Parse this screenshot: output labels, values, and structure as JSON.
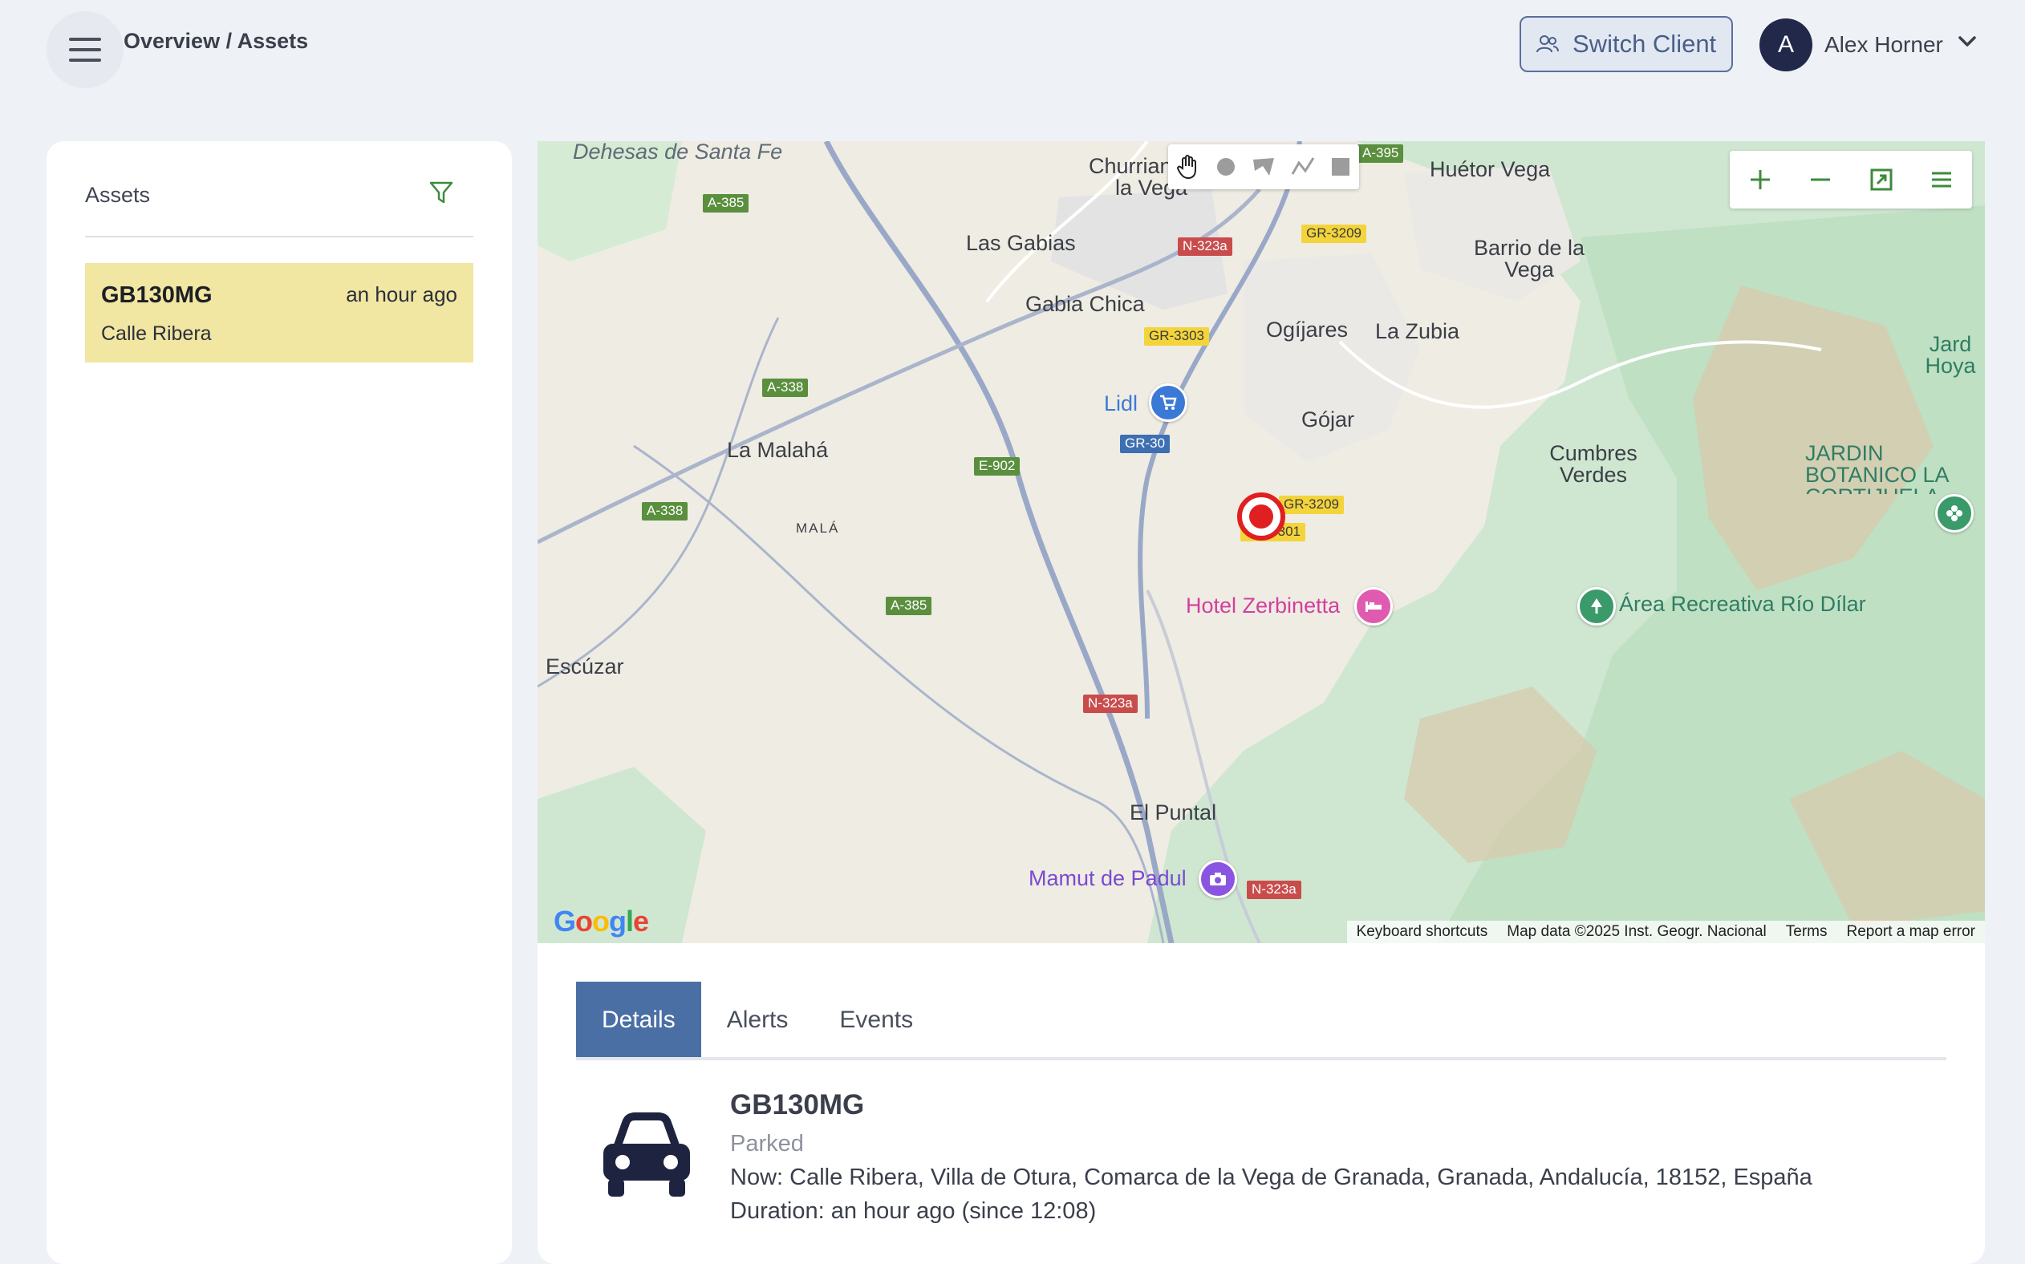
{
  "header": {
    "breadcrumb": "Overview / Assets",
    "switch_client_label": "Switch Client",
    "avatar_initial": "A",
    "user_name": "Alex Horner"
  },
  "assets_panel": {
    "title": "Assets",
    "items": [
      {
        "id": "GB130MG",
        "time": "an hour ago",
        "location": "Calle Ribera"
      }
    ]
  },
  "map": {
    "places": {
      "dehesas": "Dehesas de Santa Fe",
      "churriana": "Churriana de la Vega",
      "huetor": "Huétor Vega",
      "las_gabias": "Las Gabias",
      "barrio": "Barrio de la Vega",
      "gabia_chica": "Gabia Chica",
      "ogijares": "Ogíjares",
      "la_zubia": "La Zubia",
      "jard_hoya": "Jard Hoya",
      "lidl": "Lidl",
      "gojar": "Gójar",
      "la_malaha": "La Malahá",
      "cumbres": "Cumbres Verdes",
      "jardin": "JARDIN BOTANICO LA CORTIJUELA",
      "mala": "MALÁ",
      "hotel": "Hotel Zerbinetta",
      "area": "Área Recreativa Río Dílar",
      "escuzar": "Escúzar",
      "el_puntal": "El Puntal",
      "mamut": "Mamut de Padul"
    },
    "roads": {
      "a385a": "A-385",
      "a395": "A-395",
      "n323a_top": "N-323a",
      "gr3209a": "GR-3209",
      "gr3303": "GR-3303",
      "a338a": "A-338",
      "gr30": "GR-30",
      "e902": "E-902",
      "gr3209b": "GR-3209",
      "gr3301": "GR-3301",
      "a338b": "A-338",
      "a385b": "A-385",
      "n323a_mid": "N-323a",
      "n323a_bot": "N-323a"
    },
    "google_logo": "Google",
    "attribution": {
      "shortcuts": "Keyboard shortcuts",
      "data": "Map data ©2025 Inst. Geogr. Nacional",
      "terms": "Terms",
      "report": "Report a map error"
    }
  },
  "details": {
    "tabs": [
      "Details",
      "Alerts",
      "Events"
    ],
    "active_tab": "Details",
    "title": "GB130MG",
    "status": "Parked",
    "now": "Now: Calle Ribera, Villa de Otura, Comarca de la Vega de Granada, Granada, Andalucía, 18152, España",
    "duration": "Duration: an hour ago (since 12:08)"
  },
  "colors": {
    "accent": "#4a6fa5",
    "asset_highlight": "#f1e6a2",
    "marker": "#e02020",
    "avatar": "#22284a",
    "filter_icon": "#3c8b3c"
  }
}
